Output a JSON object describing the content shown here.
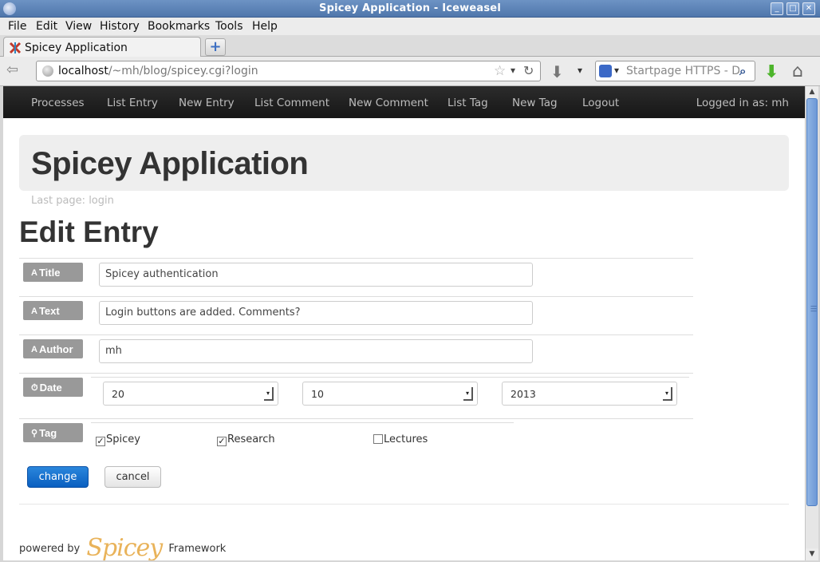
{
  "window": {
    "title": "Spicey Application - Iceweasel"
  },
  "menu": [
    "File",
    "Edit",
    "View",
    "History",
    "Bookmarks",
    "Tools",
    "Help"
  ],
  "tab": {
    "label": "Spicey Application",
    "new_tab": "+"
  },
  "nav": {
    "url_host": "localhost",
    "url_path": "/~mh/blog/spicey.cgi?login",
    "search_placeholder": "Startpage HTTPS - Def"
  },
  "topnav": {
    "items": [
      "Processes",
      "List Entry",
      "New Entry",
      "List Comment",
      "New Comment",
      "List Tag",
      "New Tag",
      "Logout"
    ],
    "logged_in": "Logged in as: mh"
  },
  "hero": {
    "title": "Spicey Application"
  },
  "last_page": "Last page: login",
  "page_title": "Edit Entry",
  "form": {
    "title_label": "Title",
    "title_value": "Spicey authentication",
    "text_label": "Text",
    "text_value": "Login buttons are added. Comments?",
    "author_label": "Author",
    "author_value": "mh",
    "date_label": "Date",
    "day": "20",
    "month": "10",
    "year": "2013",
    "tag_label": "Tag",
    "tags": [
      {
        "label": "Spicey",
        "checked": true
      },
      {
        "label": "Research",
        "checked": true
      },
      {
        "label": "Lectures",
        "checked": false
      }
    ],
    "change_label": "change",
    "cancel_label": "cancel"
  },
  "footer": {
    "prefix": "powered by",
    "logo": "Spicey",
    "suffix": "Framework"
  }
}
